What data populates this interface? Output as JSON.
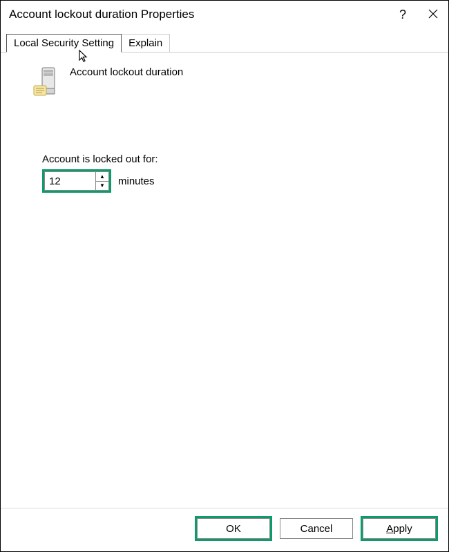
{
  "titlebar": {
    "title": "Account lockout duration Properties"
  },
  "tabs": {
    "active": "Local Security Setting",
    "inactive": "Explain"
  },
  "policy": {
    "name": "Account lockout duration"
  },
  "field": {
    "label": "Account is locked out for:",
    "value": "12",
    "unit": "minutes"
  },
  "buttons": {
    "ok": "OK",
    "cancel": "Cancel",
    "apply_prefix": "A",
    "apply_rest": "pply"
  },
  "colors": {
    "highlight": "#0d9b6b"
  }
}
